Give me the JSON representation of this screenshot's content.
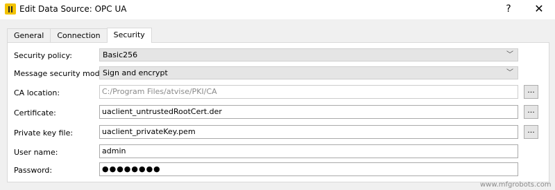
{
  "window": {
    "title": "Edit Data Source: OPC UA",
    "help_label": "?",
    "close_label": "✕"
  },
  "tabs": [
    {
      "label": "General",
      "active": false
    },
    {
      "label": "Connection",
      "active": false
    },
    {
      "label": "Security",
      "active": true
    }
  ],
  "form": {
    "security_policy": {
      "label": "Security policy:",
      "value": "Basic256"
    },
    "message_security_mode": {
      "label": "Message security mode:",
      "value": "Sign and encrypt"
    },
    "ca_location": {
      "label": "CA location:",
      "value": "C:/Program Files/atvise/PKI/CA",
      "disabled": true
    },
    "certificate": {
      "label": "Certificate:",
      "value": "uaclient_untrustedRootCert.der"
    },
    "private_key_file": {
      "label": "Private key file:",
      "value": "uaclient_privateKey.pem"
    },
    "user_name": {
      "label": "User name:",
      "value": "admin"
    },
    "password": {
      "label": "Password:",
      "value": "●●●●●●●●"
    },
    "browse_label": "..."
  },
  "watermark": "www.mfgrobots.com",
  "icons": {
    "app": "atvise-app-icon",
    "dropdown": "chevron-down-icon"
  }
}
